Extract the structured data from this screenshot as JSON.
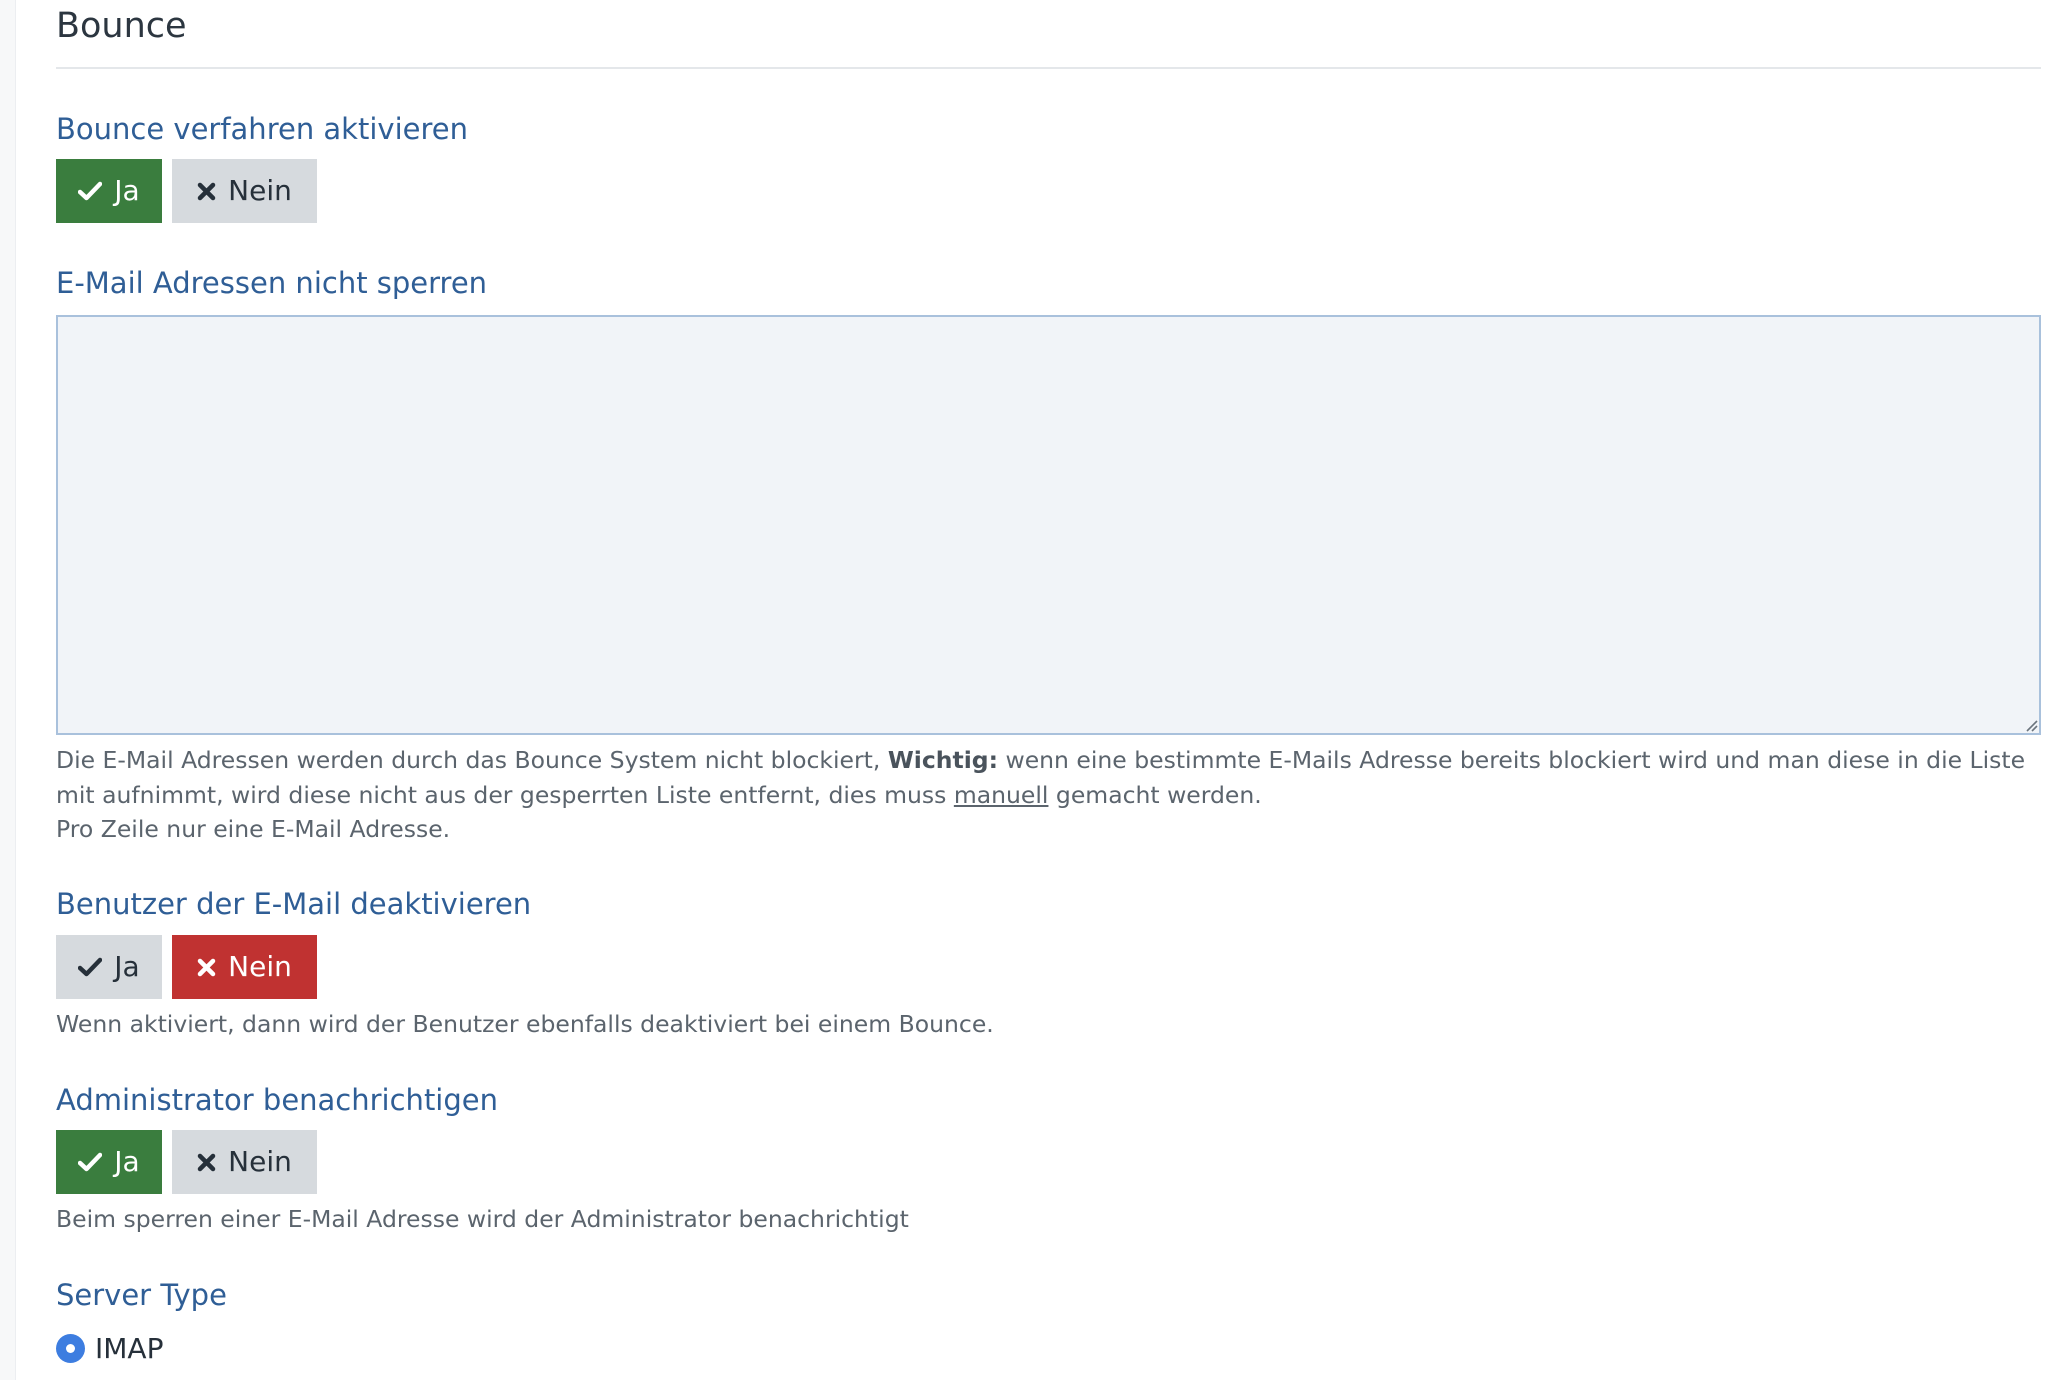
{
  "page": {
    "title": "Bounce"
  },
  "bounce_enable": {
    "label": "Bounce verfahren aktivieren",
    "yes_label": "Ja",
    "no_label": "Nein",
    "selected": "yes"
  },
  "whitelist": {
    "label": "E-Mail Adressen nicht sperren",
    "value": "",
    "help_part1": "Die E-Mail Adressen werden durch das Bounce System nicht blockiert, ",
    "help_bold": "Wichtig:",
    "help_part2": " wenn eine bestimmte E-Mails Adresse bereits blockiert wird und man diese in die Liste mit aufnimmt, wird diese nicht aus der gesperrten Liste entfernt, dies muss ",
    "help_underline": "manuell",
    "help_part3": " gemacht werden.",
    "help_line2": "Pro Zeile nur eine E-Mail Adresse."
  },
  "deactivate_user": {
    "label": "Benutzer der E-Mail deaktivieren",
    "yes_label": "Ja",
    "no_label": "Nein",
    "selected": "no",
    "help": "Wenn aktiviert, dann wird der Benutzer ebenfalls deaktiviert bei einem Bounce."
  },
  "notify_admin": {
    "label": "Administrator benachrichtigen",
    "yes_label": "Ja",
    "no_label": "Nein",
    "selected": "yes",
    "help": "Beim sperren einer E-Mail Adresse wird der Administrator benachrichtigt"
  },
  "server_type": {
    "label": "Server Type",
    "options": [
      "IMAP"
    ],
    "selected": "IMAP"
  },
  "colors": {
    "active_yes": "#3a7d3e",
    "active_no": "#c03231",
    "inactive": "#d6dade",
    "label_blue": "#2f5e96",
    "radio_blue": "#3d7de0"
  },
  "icons": {
    "yes": "check-icon",
    "no": "times-icon",
    "resize": "resize-grip-icon"
  }
}
